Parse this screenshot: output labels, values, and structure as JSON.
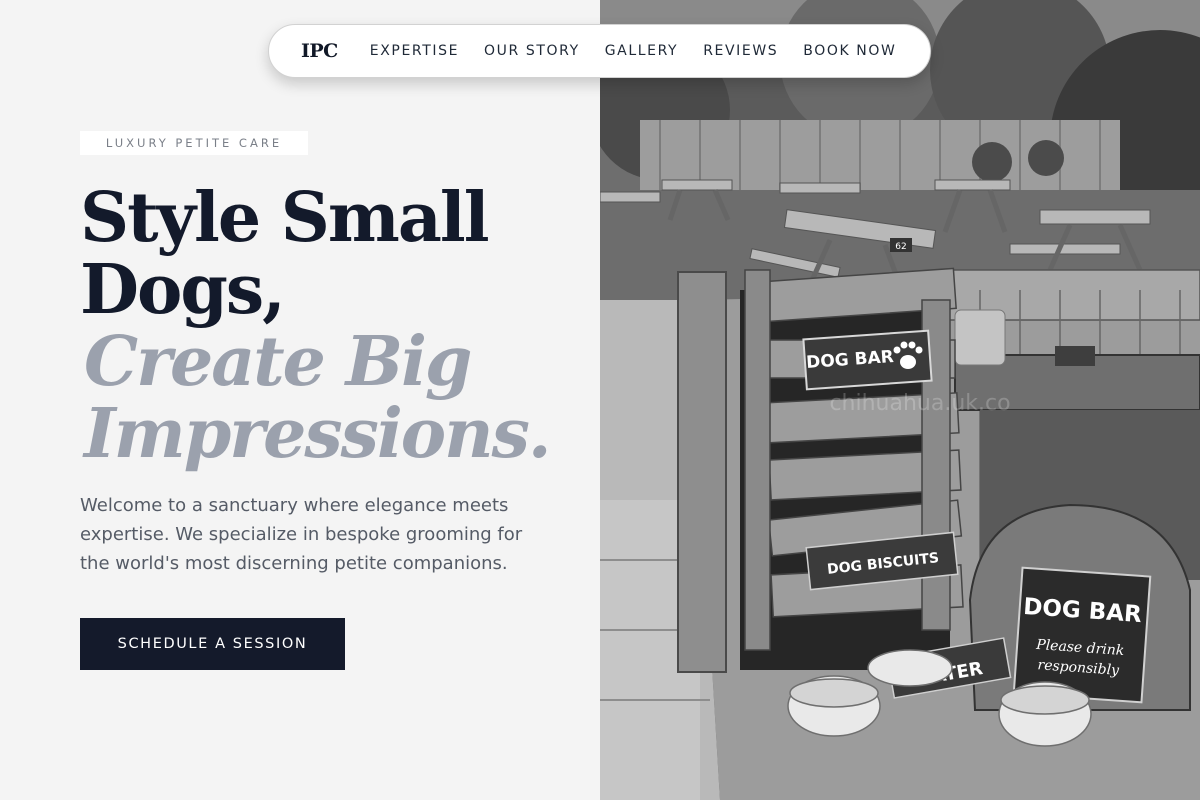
{
  "nav": {
    "logo": "IPC",
    "links": [
      "EXPERTISE",
      "OUR STORY",
      "GALLERY",
      "REVIEWS",
      "BOOK NOW"
    ]
  },
  "hero": {
    "tag": "LUXURY PETITE CARE",
    "headline_line1": "Style Small",
    "headline_line2": "Dogs,",
    "accent_line1": "Create Big",
    "accent_line2": "Impressions.",
    "intro": "Welcome to a sanctuary where elegance meets expertise. We specialize in bespoke grooming for the world's most discerning petite companions.",
    "cta_label": "SCHEDULE A SESSION"
  },
  "photo": {
    "sign_dog_bar_top": "DOG BAR",
    "sign_biscuits": "DOG BISCUITS",
    "sign_water": "WATER",
    "sign_dog_bar_main": "DOG BAR",
    "sign_drink_line1": "Please drink",
    "sign_drink_line2": "responsibly",
    "table_number": "62"
  },
  "colors": {
    "primary": "#141a2b",
    "accent_text": "#9ba1ad",
    "background": "#f4f4f4"
  }
}
